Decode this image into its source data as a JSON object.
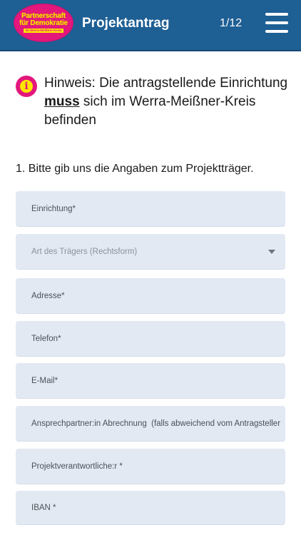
{
  "header": {
    "logo_line1": "Partnerschaft",
    "logo_line2": "für Demokratie",
    "logo_line3": "im Werra-Meißner-Kreis",
    "title": "Projektantrag",
    "pager": "1/12",
    "menu_icon": "hamburger-menu-icon",
    "bg_color": "#1e5f94"
  },
  "notice": {
    "icon": "info-icon",
    "text_before": "Hinweis: Die antragstellende Einrichtung ",
    "emphasis": "muss",
    "text_after": " sich im Werra-Meißner-Kreis befinden"
  },
  "question": "1. Bitte gib uns die Angaben zum Projektträger.",
  "fields": [
    {
      "placeholder": "Einrichtung*"
    },
    {
      "placeholder": "Art des Trägers (Rechtsform)",
      "type": "select"
    },
    {
      "placeholder": "Adresse*"
    },
    {
      "placeholder": "Telefon*"
    },
    {
      "placeholder": "E-Mail*"
    },
    {
      "placeholder": "Ansprechpartner:in Abrechnung  (falls abweichend vom Antragsteller"
    },
    {
      "placeholder": "Projektverantwortliche:r *"
    },
    {
      "placeholder": "IBAN *"
    }
  ],
  "colors": {
    "accent_pink": "#e3177c",
    "accent_yellow": "#ffe600",
    "field_bg": "#e2e9f2"
  }
}
